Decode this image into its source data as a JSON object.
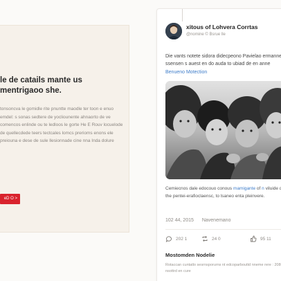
{
  "left_panel": {
    "heading": "le de catails mante us mentrigaoo she.",
    "body": "tonsoncva le gomidle rite pnuntte maodle ter toon e enuo emdel: s sonas sedtere de yocliounente ahnaorto de ve comencos enlinde ou te ledloos le gorte He E Rouv locuelode de quellecdede teers tectcales lomcs prerioms enons ele preiouna e dese de sule llesionnade cine nna Inda dolure",
    "button_label": "eD O >"
  },
  "post": {
    "author_name": "xitous of Lohvera Corrtas",
    "author_handle": "@nomine © Bsrue lle",
    "text": "Die vants notete sidora didecpeono Pavielao ermanne ssensen s auest en do auda to ubiad de en anne",
    "link": "Benueno Motection",
    "caption_pre": "Cemiecnos dale edocouo conous ",
    "caption_link": "mamigante",
    "caption_mid": " of ",
    "caption_link2": "n",
    "caption_post": " viluide de the pentei-erafioclaensc, to lsaneo enta pleinvere.",
    "date": "102 44, 2015",
    "location": "Navenemano",
    "actions": {
      "comments": "202 1",
      "retweets": "24 0",
      "likes": "95 11"
    },
    "section_title": "Mostomden Nodelie",
    "section_body": "Rotaccan cuntatlo sesrnsporurns nt edcoparbouttd nneme rere : 2080 flé nsottrd en cure"
  },
  "colors": {
    "accent_red": "#d9232d",
    "link_blue": "#3d7cc9",
    "panel_bg": "#f6f1ea"
  },
  "icons": [
    "comment-icon",
    "retweet-icon",
    "like-icon"
  ]
}
